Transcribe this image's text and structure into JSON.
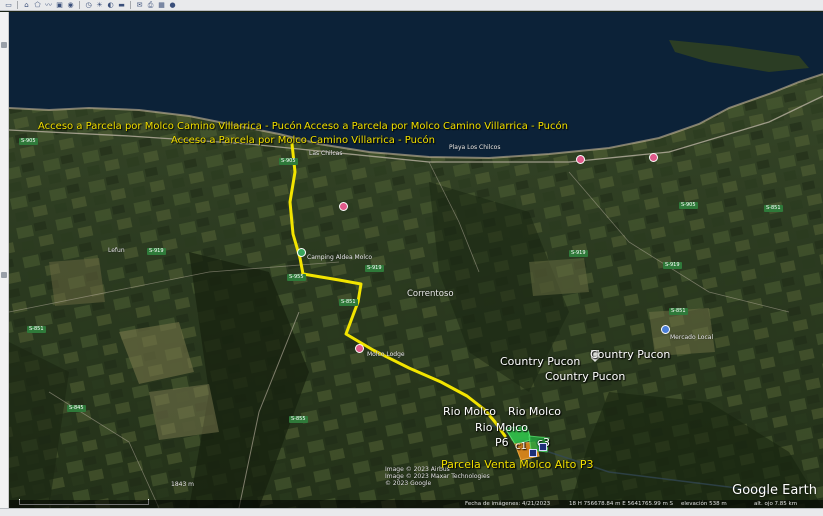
{
  "toolbar": {
    "icons": [
      "sidebar-icon",
      "placemark-icon",
      "polygon-icon",
      "path-icon",
      "overlay-icon",
      "tour-icon",
      "history-icon",
      "sun-icon",
      "planets-icon",
      "ruler-icon",
      "email-icon",
      "print-icon",
      "save-image-icon",
      "maps-icon"
    ],
    "glyphs": [
      "▭",
      "⌂",
      "⬠",
      "〰",
      "▣",
      "◉",
      "◷",
      "☀",
      "◐",
      "▬",
      "✉",
      "⎙",
      "▦",
      "●"
    ]
  },
  "map": {
    "labels": {
      "acceso_1": "Acceso a Parcela por Molco Camino Villarrica - Pucón",
      "acceso_2": "Acceso a Parcela por Molco Camino Villarrica - Pucón",
      "acceso_3": "Acceso a Parcela por Molco Camino Villarrica - Pucón",
      "country_1": "Country Pucon",
      "country_2": "Country Pucon",
      "country_3": "Country Pucon",
      "rio_1": "Rio Molco",
      "rio_2": "Rio Molco",
      "rio_3": "Rio Molco",
      "p6": "P6",
      "c1": "c1",
      "c3": "c3",
      "parcela_venta": "Parcela Venta Molco Alto P3",
      "las_chilcas": "Las Chilcas",
      "playa_chilcas": "Playa Los Chilcos",
      "camping": "Camping Aldea Molco",
      "correntoso": "Correntoso",
      "molco_lodge": "Molco Lodge",
      "mercado": "Mercado Local",
      "lefun": "Lefun"
    },
    "road_badges": [
      "S-905",
      "S-905",
      "S-919",
      "S-955",
      "S-851",
      "S-919",
      "S-919",
      "S-851",
      "S-919",
      "S-905",
      "S-851",
      "S-851",
      "S-845",
      "S-855"
    ],
    "scale": "1843 m",
    "copyright": [
      "Image © 2023 Airbus",
      "Image © 2023 Maxar Technologies",
      "© 2023 Google"
    ],
    "logo": "Google Earth",
    "status": {
      "imagery_date": "Fecha de imágenes: 4/21/2023",
      "coords": "18 H 756678.84 m E 5641765.99 m S",
      "elevation": "elevación 538 m",
      "eye_alt": "alt. ojo 7.85 km"
    }
  }
}
